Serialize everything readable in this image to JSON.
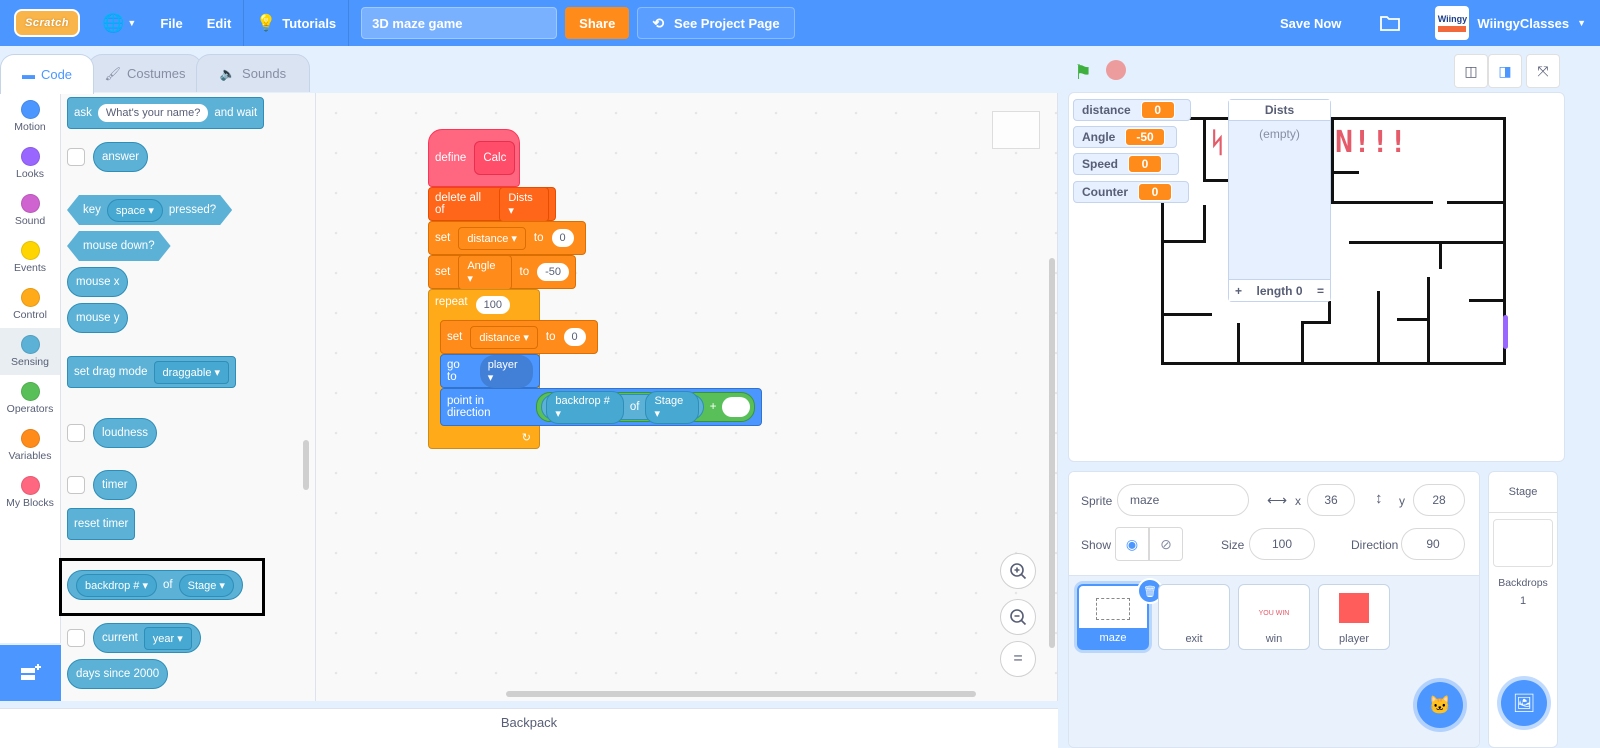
{
  "menubar": {
    "logo": "Scratch",
    "file": "File",
    "edit": "Edit",
    "tutorials": "Tutorials",
    "project_title": "3D maze game",
    "share": "Share",
    "see_project_page": "See Project Page",
    "save_now": "Save Now",
    "username": "WiingyClasses",
    "avatar_text": "Wiingy"
  },
  "tabs": [
    {
      "label": "Code",
      "icon": "code-icon",
      "active": true
    },
    {
      "label": "Costumes",
      "icon": "brush-icon",
      "active": false
    },
    {
      "label": "Sounds",
      "icon": "speaker-icon",
      "active": false
    }
  ],
  "categories": [
    {
      "label": "Motion",
      "color": "#4c97ff"
    },
    {
      "label": "Looks",
      "color": "#9966ff"
    },
    {
      "label": "Sound",
      "color": "#cf63cf"
    },
    {
      "label": "Events",
      "color": "#ffd500"
    },
    {
      "label": "Control",
      "color": "#ffab19"
    },
    {
      "label": "Sensing",
      "color": "#5cb1d6",
      "active": true
    },
    {
      "label": "Operators",
      "color": "#59c059"
    },
    {
      "label": "Variables",
      "color": "#ff8c1a"
    },
    {
      "label": "My Blocks",
      "color": "#ff6680"
    }
  ],
  "palette": {
    "ask": "ask",
    "ask_input": "What's your name?",
    "and_wait": "and wait",
    "answer": "answer",
    "key": "key",
    "key_value": "space",
    "pressed": "pressed?",
    "mouse_down": "mouse down?",
    "mouse_x": "mouse x",
    "mouse_y": "mouse y",
    "set_drag_mode": "set drag mode",
    "drag_value": "draggable",
    "loudness": "loudness",
    "timer": "timer",
    "reset_timer": "reset timer",
    "backdrop": "backdrop #",
    "of": "of",
    "stage": "Stage",
    "current": "current",
    "year": "year",
    "days_since": "days since 2000"
  },
  "script": {
    "define": "define",
    "proc_name": "Calc",
    "delete_all_of": "delete all of",
    "list_name": "Dists",
    "set": "set",
    "to": "to",
    "var_distance": "distance",
    "val_distance": "0",
    "var_angle": "Angle",
    "val_angle": "-50",
    "repeat": "repeat",
    "repeat_count": "100",
    "inner_var": "distance",
    "inner_val": "0",
    "go_to": "go to",
    "go_target": "player",
    "point_in_direction": "point in direction",
    "backdrop": "backdrop #",
    "of": "of",
    "stage": "Stage",
    "plus": "+",
    "loop_arrow": "↻"
  },
  "workspace": {
    "zoom_in": "+",
    "zoom_out": "−",
    "reset": "="
  },
  "backpack": "Backpack",
  "stage": {
    "monitors": [
      {
        "name": "distance",
        "value": "0"
      },
      {
        "name": "Angle",
        "value": "-50"
      },
      {
        "name": "Speed",
        "value": "0"
      },
      {
        "name": "Counter",
        "value": "0"
      }
    ],
    "list": {
      "name": "Dists",
      "empty": "(empty)",
      "add": "+",
      "length": "length 0",
      "resize": "="
    },
    "banner_text": "N!!!"
  },
  "sprite_info": {
    "sprite_label": "Sprite",
    "sprite_name": "maze",
    "x_label": "x",
    "x": "36",
    "y_label": "y",
    "y": "28",
    "show_label": "Show",
    "size_label": "Size",
    "size": "100",
    "direction_label": "Direction",
    "direction": "90"
  },
  "sprites": [
    {
      "name": "maze",
      "selected": true
    },
    {
      "name": "exit",
      "selected": false
    },
    {
      "name": "win",
      "thumb_text": "YOU WIN",
      "selected": false
    },
    {
      "name": "player",
      "thumb_color": "#ff5c5c",
      "selected": false
    }
  ],
  "stage_panel": {
    "title": "Stage",
    "backdrops_label": "Backdrops",
    "backdrops_count": "1"
  }
}
